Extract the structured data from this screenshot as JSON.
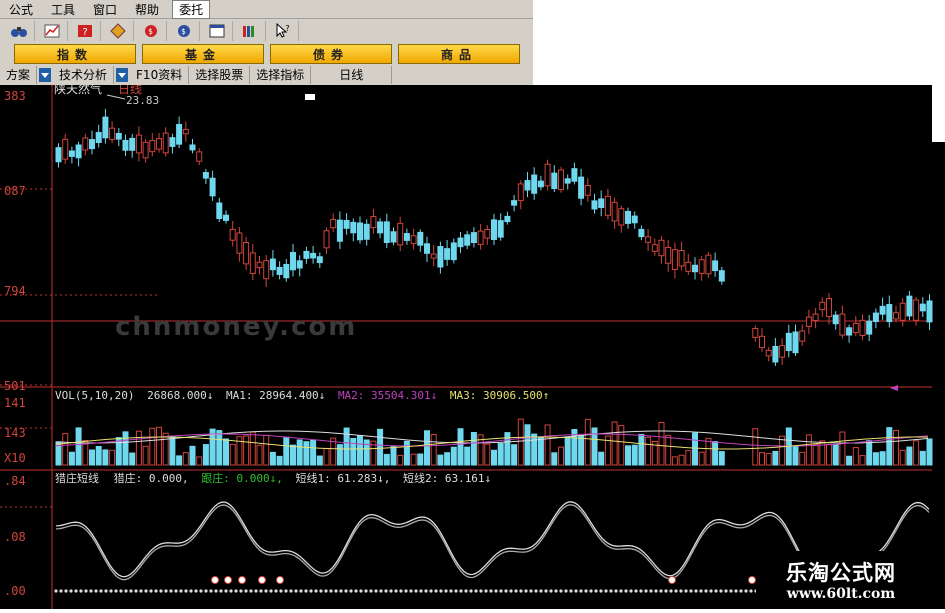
{
  "menu": [
    "公式",
    "工具",
    "窗口",
    "帮助",
    "委托"
  ],
  "categories": [
    "指数",
    "基金",
    "债券",
    "商品"
  ],
  "tabs": [
    "方案",
    "技术分析",
    "F10资料",
    "选择股票",
    "选择指标",
    "日线"
  ],
  "chart": {
    "stock": "陕天然气",
    "period": "日线",
    "high_label": "23.83",
    "price_axis": [
      "383",
      "087",
      "794",
      "501"
    ],
    "vol_axis": [
      "141",
      "143",
      "X10"
    ],
    "ind_axis": [
      ".84",
      ".08",
      ".00"
    ],
    "watermark": "chnmoney.com"
  },
  "vol_header": {
    "prefix": "VOL(5,10,20)",
    "value": "26868.000↓",
    "ma1": "MA1: 28964.400↓",
    "ma2": "MA2: 35504.301↓",
    "ma3": "MA3: 30906.500↑"
  },
  "ind_header": {
    "name": "猎庄短线",
    "s1": "猎庄: 0.000,",
    "s2": "跟庄: 0.000↓,",
    "s3": "短线1: 61.283↓,",
    "s4": "短线2: 63.161↓"
  },
  "watermark_box": {
    "title": "乐淘公式网",
    "url": "www.60lt.com"
  },
  "colors": {
    "up": "#d0453c",
    "down": "#6fd8ee",
    "ma2": "#c040c0",
    "ma3": "#e8e070",
    "follow": "#30c030"
  }
}
